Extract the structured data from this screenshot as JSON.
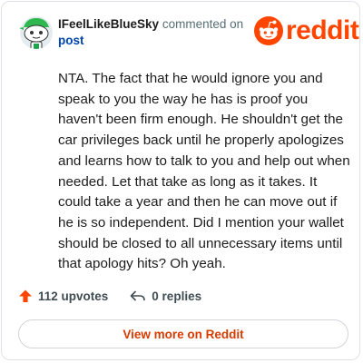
{
  "comment": {
    "username": "IFeelLikeBlueSky",
    "action_text": " commented on ",
    "target_text": "post",
    "body": "NTA. The fact that he would ignore you and speak to you the way he has is proof you haven't been firm enough. He shouldn't get the car privileges back until he properly apologizes and learns how to talk to you and help out when needed. Let that take as long as it takes. It could take a year and then he can move out if he is so independent. Did I mention your wallet should be closed to all unnecessary items until that apology hits? Oh yeah."
  },
  "brand": {
    "logo_text": "reddit",
    "color": "#ff4500"
  },
  "stats": {
    "upvotes": "112 upvotes",
    "replies": "0 replies"
  },
  "cta": {
    "label": "View more on Reddit"
  },
  "icons": {
    "avatar": "snoo-avatar",
    "upvote": "upvote-arrow-icon",
    "reply": "reply-arrow-icon",
    "logo": "reddit-snoo-icon"
  }
}
